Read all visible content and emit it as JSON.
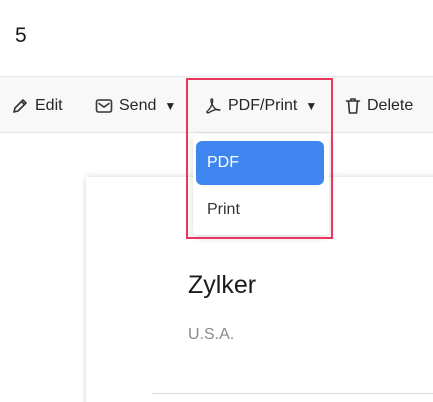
{
  "header": {
    "page_number": "5"
  },
  "toolbar": {
    "edit_label": "Edit",
    "send_label": "Send",
    "pdf_print_label": "PDF/Print",
    "delete_label": "Delete"
  },
  "dropdown": {
    "items": [
      {
        "label": "PDF",
        "selected": true
      },
      {
        "label": "Print",
        "selected": false
      }
    ]
  },
  "document": {
    "company": "Zylker",
    "country": "U.S.A."
  },
  "colors": {
    "highlight_border": "#e8365c",
    "selected_item": "#3f86f0",
    "toolbar_bg": "#f8f8f9"
  },
  "icons": [
    "pencil-icon",
    "envelope-icon",
    "pdf-icon",
    "trash-icon",
    "caret-down-icon"
  ]
}
